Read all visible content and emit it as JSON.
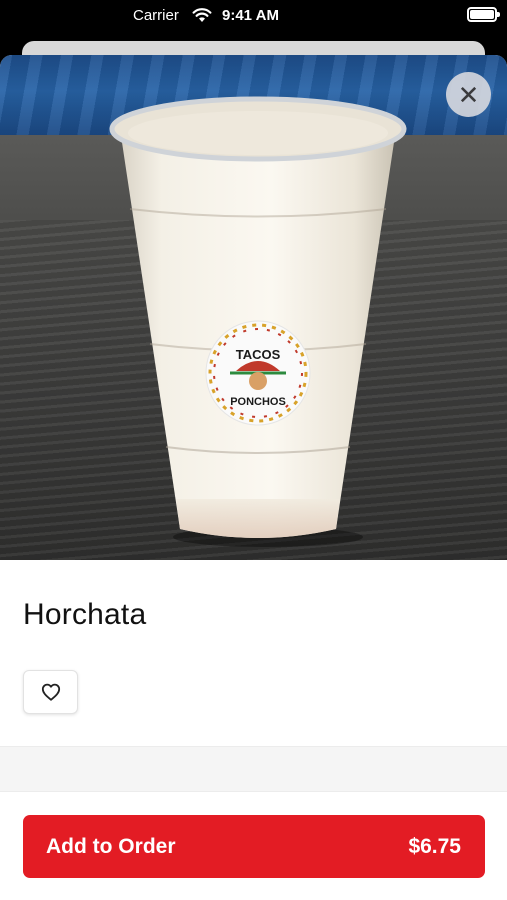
{
  "status_bar": {
    "carrier": "Carrier",
    "time": "9:41 AM",
    "icons": [
      "wifi-icon",
      "battery-icon"
    ]
  },
  "close_button": {
    "icon": "close-icon",
    "glyph": "✕"
  },
  "hero": {
    "sticker_top_text": "TACOS",
    "sticker_bottom_text": "PONCHOS"
  },
  "item": {
    "name": "Horchata"
  },
  "favorite_button": {
    "icon": "heart-icon"
  },
  "order": {
    "label": "Add to Order",
    "price": "$6.75",
    "accent_color": "#e31c24"
  }
}
